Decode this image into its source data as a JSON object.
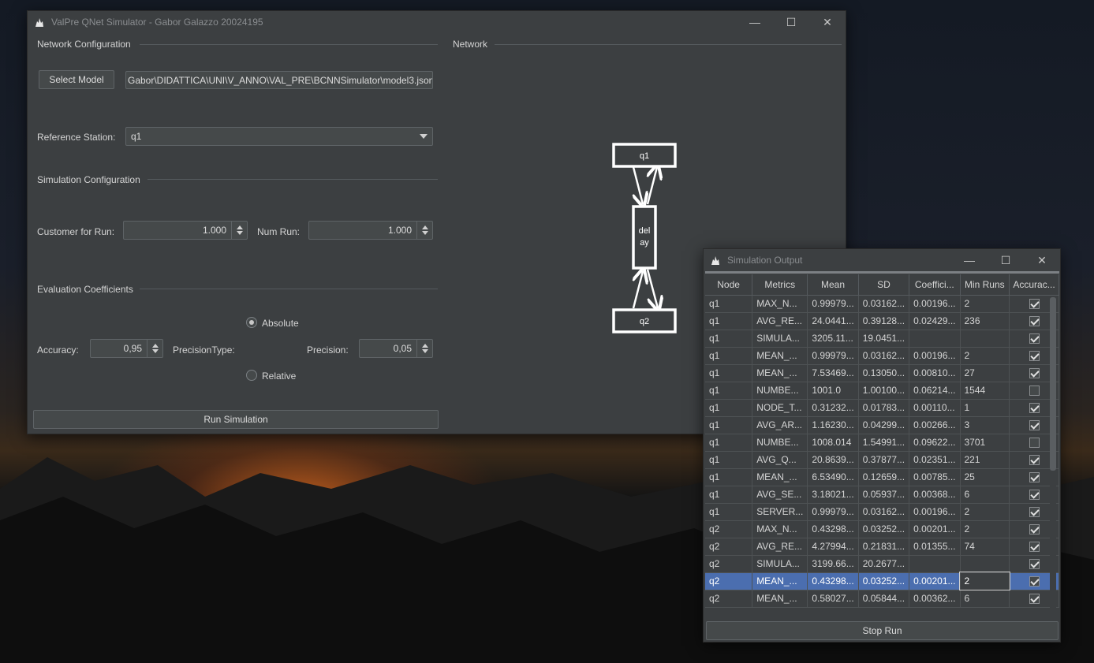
{
  "main_window": {
    "title": "ValPre QNet Simulator - Gabor Galazzo 20024195",
    "network_config": {
      "group_title": "Network Configuration",
      "select_model_label": "Select Model",
      "model_path": "Gabor\\DIDATTICA\\UNI\\V_ANNO\\VAL_PRE\\BCNNSimulator\\model3.json",
      "reference_station_label": "Reference Station:",
      "reference_station_value": "q1"
    },
    "simulation_config": {
      "group_title": "Simulation Configuration",
      "customer_label": "Customer for Run:",
      "customer_value": "1.000",
      "num_run_label": "Num Run:",
      "num_run_value": "1.000"
    },
    "evaluation": {
      "group_title": "Evaluation Coefficients",
      "accuracy_label": "Accuracy:",
      "accuracy_value": "0,95",
      "precision_type_label": "PrecisionType:",
      "absolute_label": "Absolute",
      "relative_label": "Relative",
      "precision_label": "Precision:",
      "precision_value": "0,05"
    },
    "run_label": "Run Simulation",
    "network": {
      "group_title": "Network",
      "nodes": {
        "q1": "q1",
        "delay_line1": "del",
        "delay_line2": "ay",
        "q2": "q2"
      }
    }
  },
  "output_window": {
    "title": "Simulation Output",
    "columns": [
      "Node",
      "Metrics",
      "Mean",
      "SD",
      "Coeffici...",
      "Min Runs",
      "Accurac..."
    ],
    "rows": [
      {
        "node": "q1",
        "metric": "MAX_N...",
        "mean": "0.99979...",
        "sd": "0.03162...",
        "coef": "0.00196...",
        "minruns": "2",
        "acc": true
      },
      {
        "node": "q1",
        "metric": "AVG_RE...",
        "mean": "24.0441...",
        "sd": "0.39128...",
        "coef": "0.02429...",
        "minruns": "236",
        "acc": true
      },
      {
        "node": "q1",
        "metric": "SIMULA...",
        "mean": "3205.11...",
        "sd": "19.0451...",
        "coef": "",
        "minruns": "",
        "acc": true
      },
      {
        "node": "q1",
        "metric": "MEAN_...",
        "mean": "0.99979...",
        "sd": "0.03162...",
        "coef": "0.00196...",
        "minruns": "2",
        "acc": true
      },
      {
        "node": "q1",
        "metric": "MEAN_...",
        "mean": "7.53469...",
        "sd": "0.13050...",
        "coef": "0.00810...",
        "minruns": "27",
        "acc": true
      },
      {
        "node": "q1",
        "metric": "NUMBE...",
        "mean": "1001.0",
        "sd": "1.00100...",
        "coef": "0.06214...",
        "minruns": "1544",
        "acc": false
      },
      {
        "node": "q1",
        "metric": "NODE_T...",
        "mean": "0.31232...",
        "sd": "0.01783...",
        "coef": "0.00110...",
        "minruns": "1",
        "acc": true
      },
      {
        "node": "q1",
        "metric": "AVG_AR...",
        "mean": "1.16230...",
        "sd": "0.04299...",
        "coef": "0.00266...",
        "minruns": "3",
        "acc": true
      },
      {
        "node": "q1",
        "metric": "NUMBE...",
        "mean": "1008.014",
        "sd": "1.54991...",
        "coef": "0.09622...",
        "minruns": "3701",
        "acc": false
      },
      {
        "node": "q1",
        "metric": "AVG_Q...",
        "mean": "20.8639...",
        "sd": "0.37877...",
        "coef": "0.02351...",
        "minruns": "221",
        "acc": true
      },
      {
        "node": "q1",
        "metric": "MEAN_...",
        "mean": "6.53490...",
        "sd": "0.12659...",
        "coef": "0.00785...",
        "minruns": "25",
        "acc": true
      },
      {
        "node": "q1",
        "metric": "AVG_SE...",
        "mean": "3.18021...",
        "sd": "0.05937...",
        "coef": "0.00368...",
        "minruns": "6",
        "acc": true
      },
      {
        "node": "q1",
        "metric": "SERVER...",
        "mean": "0.99979...",
        "sd": "0.03162...",
        "coef": "0.00196...",
        "minruns": "2",
        "acc": true
      },
      {
        "node": "q2",
        "metric": "MAX_N...",
        "mean": "0.43298...",
        "sd": "0.03252...",
        "coef": "0.00201...",
        "minruns": "2",
        "acc": true
      },
      {
        "node": "q2",
        "metric": "AVG_RE...",
        "mean": "4.27994...",
        "sd": "0.21831...",
        "coef": "0.01355...",
        "minruns": "74",
        "acc": true
      },
      {
        "node": "q2",
        "metric": "SIMULA...",
        "mean": "3199.66...",
        "sd": "20.2677...",
        "coef": "",
        "minruns": "",
        "acc": true
      },
      {
        "node": "q2",
        "metric": "MEAN_...",
        "mean": "0.43298...",
        "sd": "0.03252...",
        "coef": "0.00201...",
        "minruns": "2",
        "acc": true,
        "selected": true
      },
      {
        "node": "q2",
        "metric": "MEAN_...",
        "mean": "0.58027...",
        "sd": "0.05844...",
        "coef": "0.00362...",
        "minruns": "6",
        "acc": true
      }
    ],
    "stop_label": "Stop Run"
  }
}
